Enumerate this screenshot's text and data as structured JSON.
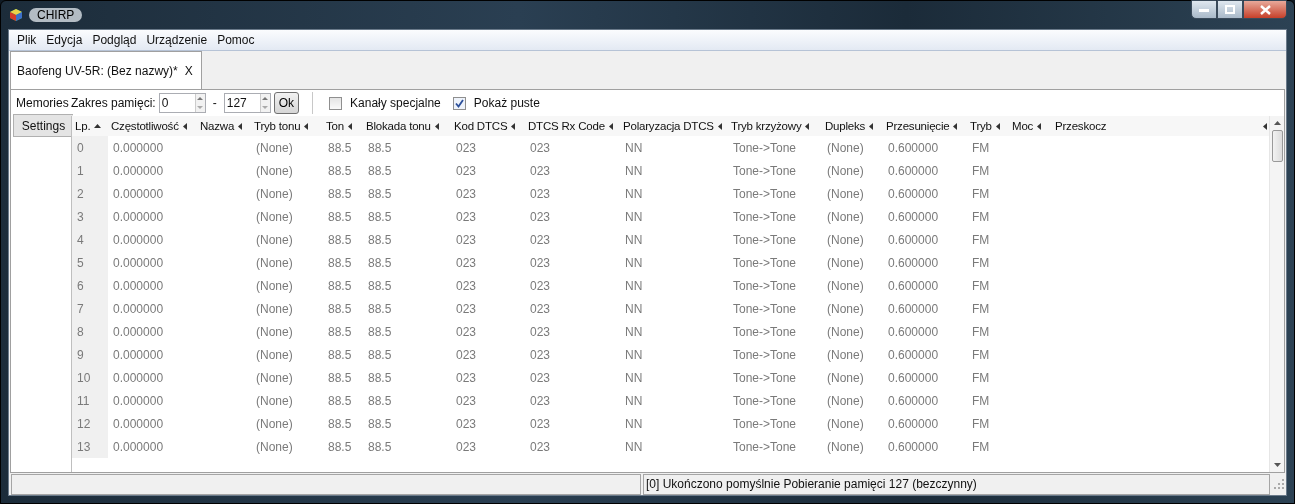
{
  "window": {
    "title": "CHIRP"
  },
  "menu": [
    {
      "label": "Plik"
    },
    {
      "label": "Edycja"
    },
    {
      "label": "Podgląd"
    },
    {
      "label": "Urządzenie"
    },
    {
      "label": "Pomoc"
    }
  ],
  "file_tabs": [
    {
      "label": "Baofeng UV-5R: (Bez nazwy)*",
      "close": "X",
      "selected": true
    }
  ],
  "side_tabs": [
    {
      "label": "Memories",
      "selected": true
    },
    {
      "label": "Settings",
      "selected": false
    }
  ],
  "toolbar": {
    "range_label": "Zakres pamięci:",
    "range_from": "0",
    "separator": "-",
    "range_to": "127",
    "ok": "Ok",
    "checkboxes": [
      {
        "label": "Kanały specjalne",
        "checked": false
      },
      {
        "label": "Pokaż puste",
        "checked": true
      }
    ]
  },
  "table": {
    "columns": [
      {
        "label": "Lp.",
        "sorted": true
      },
      {
        "label": "Częstotliwość",
        "sorted": false
      },
      {
        "label": "Nazwa",
        "sorted": false
      },
      {
        "label": "Tryb tonu",
        "sorted": false
      },
      {
        "label": "Ton",
        "sorted": false
      },
      {
        "label": "Blokada tonu",
        "sorted": false
      },
      {
        "label": "Kod DTCS",
        "sorted": false
      },
      {
        "label": "DTCS Rx Code",
        "sorted": false
      },
      {
        "label": "Polaryzacja DTCS",
        "sorted": false
      },
      {
        "label": "Tryb krzyżowy",
        "sorted": false
      },
      {
        "label": "Dupleks",
        "sorted": false
      },
      {
        "label": "Przesunięcie",
        "sorted": false
      },
      {
        "label": "Tryb",
        "sorted": false
      },
      {
        "label": "Moc",
        "sorted": false
      },
      {
        "label": "Przeskocz",
        "sorted": false
      }
    ],
    "rows": [
      [
        "0",
        "0.000000",
        null,
        "(None)",
        "88.5",
        "88.5",
        "023",
        "023",
        "NN",
        "Tone->Tone",
        "(None)",
        "0.600000",
        "FM",
        null,
        null
      ],
      [
        "1",
        "0.000000",
        null,
        "(None)",
        "88.5",
        "88.5",
        "023",
        "023",
        "NN",
        "Tone->Tone",
        "(None)",
        "0.600000",
        "FM",
        null,
        null
      ],
      [
        "2",
        "0.000000",
        null,
        "(None)",
        "88.5",
        "88.5",
        "023",
        "023",
        "NN",
        "Tone->Tone",
        "(None)",
        "0.600000",
        "FM",
        null,
        null
      ],
      [
        "3",
        "0.000000",
        null,
        "(None)",
        "88.5",
        "88.5",
        "023",
        "023",
        "NN",
        "Tone->Tone",
        "(None)",
        "0.600000",
        "FM",
        null,
        null
      ],
      [
        "4",
        "0.000000",
        null,
        "(None)",
        "88.5",
        "88.5",
        "023",
        "023",
        "NN",
        "Tone->Tone",
        "(None)",
        "0.600000",
        "FM",
        null,
        null
      ],
      [
        "5",
        "0.000000",
        null,
        "(None)",
        "88.5",
        "88.5",
        "023",
        "023",
        "NN",
        "Tone->Tone",
        "(None)",
        "0.600000",
        "FM",
        null,
        null
      ],
      [
        "6",
        "0.000000",
        null,
        "(None)",
        "88.5",
        "88.5",
        "023",
        "023",
        "NN",
        "Tone->Tone",
        "(None)",
        "0.600000",
        "FM",
        null,
        null
      ],
      [
        "7",
        "0.000000",
        null,
        "(None)",
        "88.5",
        "88.5",
        "023",
        "023",
        "NN",
        "Tone->Tone",
        "(None)",
        "0.600000",
        "FM",
        null,
        null
      ],
      [
        "8",
        "0.000000",
        null,
        "(None)",
        "88.5",
        "88.5",
        "023",
        "023",
        "NN",
        "Tone->Tone",
        "(None)",
        "0.600000",
        "FM",
        null,
        null
      ],
      [
        "9",
        "0.000000",
        null,
        "(None)",
        "88.5",
        "88.5",
        "023",
        "023",
        "NN",
        "Tone->Tone",
        "(None)",
        "0.600000",
        "FM",
        null,
        null
      ],
      [
        "10",
        "0.000000",
        null,
        "(None)",
        "88.5",
        "88.5",
        "023",
        "023",
        "NN",
        "Tone->Tone",
        "(None)",
        "0.600000",
        "FM",
        null,
        null
      ],
      [
        "11",
        "0.000000",
        null,
        "(None)",
        "88.5",
        "88.5",
        "023",
        "023",
        "NN",
        "Tone->Tone",
        "(None)",
        "0.600000",
        "FM",
        null,
        null
      ],
      [
        "12",
        "0.000000",
        null,
        "(None)",
        "88.5",
        "88.5",
        "023",
        "023",
        "NN",
        "Tone->Tone",
        "(None)",
        "0.600000",
        "FM",
        null,
        null
      ],
      [
        "13",
        "0.000000",
        null,
        "(None)",
        "88.5",
        "88.5",
        "023",
        "023",
        "NN",
        "Tone->Tone",
        "(None)",
        "0.600000",
        "FM",
        null,
        null
      ]
    ]
  },
  "status_bar": {
    "message": "[0] Ukończono pomyślnie Pobieranie pamięci 127 (bezczynny)"
  }
}
